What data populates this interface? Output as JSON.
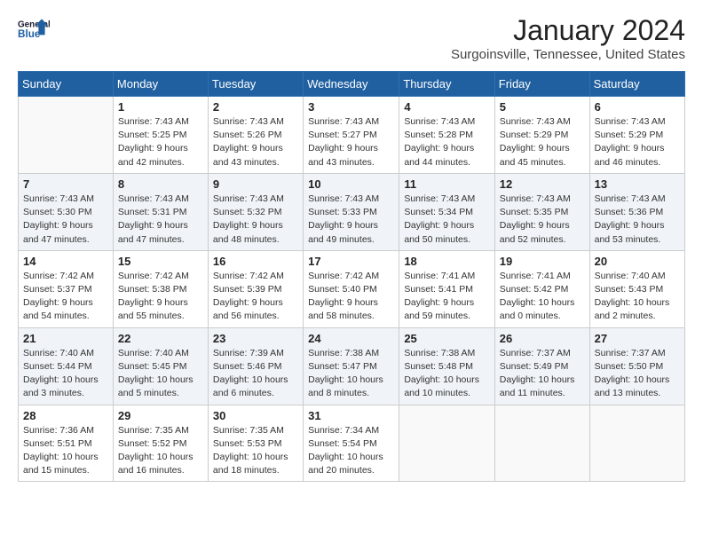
{
  "header": {
    "logo_line1": "General",
    "logo_line2": "Blue",
    "month": "January 2024",
    "location": "Surgoinsville, Tennessee, United States"
  },
  "weekdays": [
    "Sunday",
    "Monday",
    "Tuesday",
    "Wednesday",
    "Thursday",
    "Friday",
    "Saturday"
  ],
  "weeks": [
    [
      {
        "day": "",
        "info": ""
      },
      {
        "day": "1",
        "info": "Sunrise: 7:43 AM\nSunset: 5:25 PM\nDaylight: 9 hours\nand 42 minutes."
      },
      {
        "day": "2",
        "info": "Sunrise: 7:43 AM\nSunset: 5:26 PM\nDaylight: 9 hours\nand 43 minutes."
      },
      {
        "day": "3",
        "info": "Sunrise: 7:43 AM\nSunset: 5:27 PM\nDaylight: 9 hours\nand 43 minutes."
      },
      {
        "day": "4",
        "info": "Sunrise: 7:43 AM\nSunset: 5:28 PM\nDaylight: 9 hours\nand 44 minutes."
      },
      {
        "day": "5",
        "info": "Sunrise: 7:43 AM\nSunset: 5:29 PM\nDaylight: 9 hours\nand 45 minutes."
      },
      {
        "day": "6",
        "info": "Sunrise: 7:43 AM\nSunset: 5:29 PM\nDaylight: 9 hours\nand 46 minutes."
      }
    ],
    [
      {
        "day": "7",
        "info": "Sunrise: 7:43 AM\nSunset: 5:30 PM\nDaylight: 9 hours\nand 47 minutes."
      },
      {
        "day": "8",
        "info": "Sunrise: 7:43 AM\nSunset: 5:31 PM\nDaylight: 9 hours\nand 47 minutes."
      },
      {
        "day": "9",
        "info": "Sunrise: 7:43 AM\nSunset: 5:32 PM\nDaylight: 9 hours\nand 48 minutes."
      },
      {
        "day": "10",
        "info": "Sunrise: 7:43 AM\nSunset: 5:33 PM\nDaylight: 9 hours\nand 49 minutes."
      },
      {
        "day": "11",
        "info": "Sunrise: 7:43 AM\nSunset: 5:34 PM\nDaylight: 9 hours\nand 50 minutes."
      },
      {
        "day": "12",
        "info": "Sunrise: 7:43 AM\nSunset: 5:35 PM\nDaylight: 9 hours\nand 52 minutes."
      },
      {
        "day": "13",
        "info": "Sunrise: 7:43 AM\nSunset: 5:36 PM\nDaylight: 9 hours\nand 53 minutes."
      }
    ],
    [
      {
        "day": "14",
        "info": "Sunrise: 7:42 AM\nSunset: 5:37 PM\nDaylight: 9 hours\nand 54 minutes."
      },
      {
        "day": "15",
        "info": "Sunrise: 7:42 AM\nSunset: 5:38 PM\nDaylight: 9 hours\nand 55 minutes."
      },
      {
        "day": "16",
        "info": "Sunrise: 7:42 AM\nSunset: 5:39 PM\nDaylight: 9 hours\nand 56 minutes."
      },
      {
        "day": "17",
        "info": "Sunrise: 7:42 AM\nSunset: 5:40 PM\nDaylight: 9 hours\nand 58 minutes."
      },
      {
        "day": "18",
        "info": "Sunrise: 7:41 AM\nSunset: 5:41 PM\nDaylight: 9 hours\nand 59 minutes."
      },
      {
        "day": "19",
        "info": "Sunrise: 7:41 AM\nSunset: 5:42 PM\nDaylight: 10 hours\nand 0 minutes."
      },
      {
        "day": "20",
        "info": "Sunrise: 7:40 AM\nSunset: 5:43 PM\nDaylight: 10 hours\nand 2 minutes."
      }
    ],
    [
      {
        "day": "21",
        "info": "Sunrise: 7:40 AM\nSunset: 5:44 PM\nDaylight: 10 hours\nand 3 minutes."
      },
      {
        "day": "22",
        "info": "Sunrise: 7:40 AM\nSunset: 5:45 PM\nDaylight: 10 hours\nand 5 minutes."
      },
      {
        "day": "23",
        "info": "Sunrise: 7:39 AM\nSunset: 5:46 PM\nDaylight: 10 hours\nand 6 minutes."
      },
      {
        "day": "24",
        "info": "Sunrise: 7:38 AM\nSunset: 5:47 PM\nDaylight: 10 hours\nand 8 minutes."
      },
      {
        "day": "25",
        "info": "Sunrise: 7:38 AM\nSunset: 5:48 PM\nDaylight: 10 hours\nand 10 minutes."
      },
      {
        "day": "26",
        "info": "Sunrise: 7:37 AM\nSunset: 5:49 PM\nDaylight: 10 hours\nand 11 minutes."
      },
      {
        "day": "27",
        "info": "Sunrise: 7:37 AM\nSunset: 5:50 PM\nDaylight: 10 hours\nand 13 minutes."
      }
    ],
    [
      {
        "day": "28",
        "info": "Sunrise: 7:36 AM\nSunset: 5:51 PM\nDaylight: 10 hours\nand 15 minutes."
      },
      {
        "day": "29",
        "info": "Sunrise: 7:35 AM\nSunset: 5:52 PM\nDaylight: 10 hours\nand 16 minutes."
      },
      {
        "day": "30",
        "info": "Sunrise: 7:35 AM\nSunset: 5:53 PM\nDaylight: 10 hours\nand 18 minutes."
      },
      {
        "day": "31",
        "info": "Sunrise: 7:34 AM\nSunset: 5:54 PM\nDaylight: 10 hours\nand 20 minutes."
      },
      {
        "day": "",
        "info": ""
      },
      {
        "day": "",
        "info": ""
      },
      {
        "day": "",
        "info": ""
      }
    ]
  ]
}
